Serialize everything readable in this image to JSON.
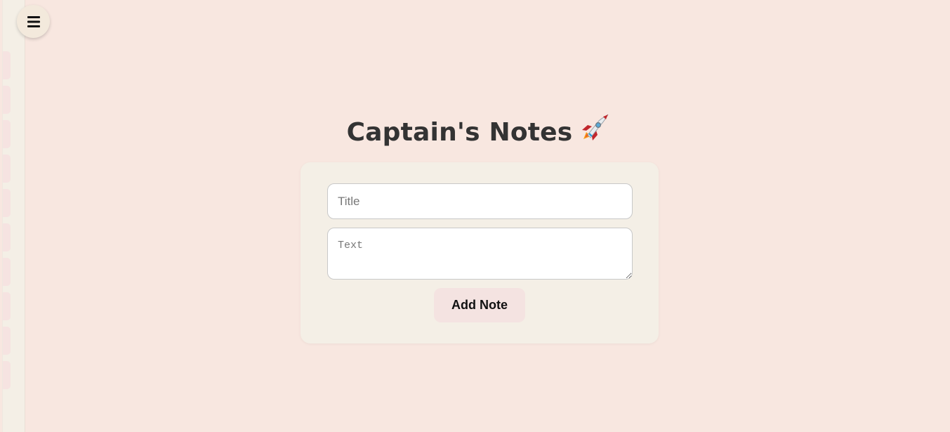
{
  "app": {
    "title": "Captain's Notes",
    "title_emoji_icon": "rocket-icon"
  },
  "sidebar": {
    "toggle_icon": "hamburger-menu-icon",
    "collapsed_tab_count": 10
  },
  "form": {
    "title_placeholder": "Title",
    "title_value": "",
    "text_placeholder": "Text",
    "text_value": "",
    "submit_label": "Add Note"
  },
  "colors": {
    "page_background": "#f8e7e0",
    "card_background": "#f4efe6",
    "button_background": "#f4e3e1",
    "heading_text": "#333333"
  }
}
